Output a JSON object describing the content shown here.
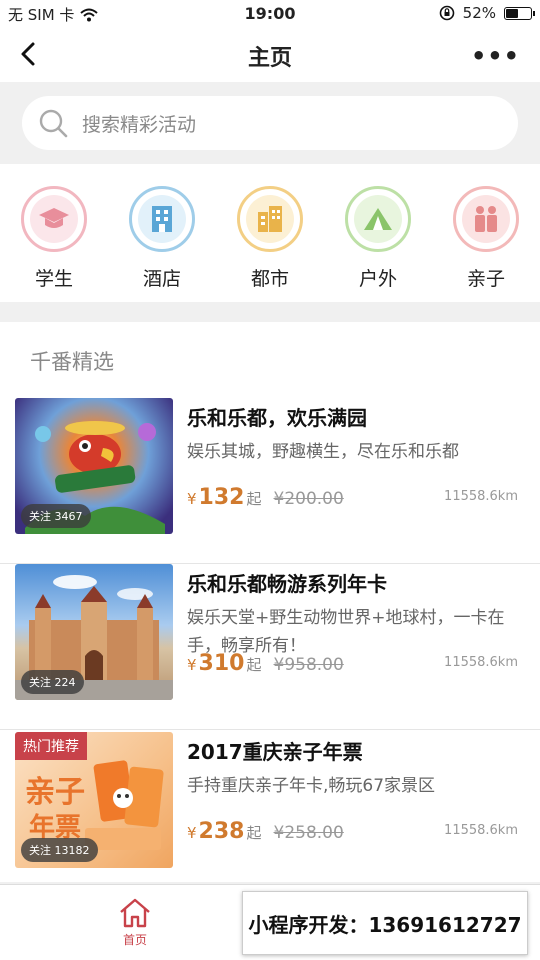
{
  "status_bar": {
    "carrier": "无 SIM 卡",
    "time": "19:00",
    "battery": "52%",
    "battery_level": 0.52
  },
  "nav": {
    "title": "主页"
  },
  "search": {
    "placeholder": "搜索精彩活动"
  },
  "categories": [
    {
      "label": "学生",
      "icon": "graduation-cap-icon",
      "color": "#e88e9b"
    },
    {
      "label": "酒店",
      "icon": "hotel-icon",
      "color": "#5aa6d6"
    },
    {
      "label": "都市",
      "icon": "city-icon",
      "color": "#e9b34a"
    },
    {
      "label": "户外",
      "icon": "tent-icon",
      "color": "#8ac46a"
    },
    {
      "label": "亲子",
      "icon": "family-icon",
      "color": "#e58a8a"
    }
  ],
  "section": {
    "title": "千番精选"
  },
  "items": [
    {
      "name": "乐和乐都，欢乐满园",
      "desc": "娱乐其城，野趣横生，尽在乐和乐都",
      "currency": "¥",
      "price": "132",
      "suffix": "起",
      "original_price": "¥200.00",
      "distance": "11558.6km",
      "follow": "关注 3467",
      "badge": ""
    },
    {
      "name": "乐和乐都畅游系列年卡",
      "desc": "娱乐天堂+野生动物世界+地球村，一卡在手，畅享所有！",
      "currency": "¥",
      "price": "310",
      "suffix": "起",
      "original_price": "¥958.00",
      "distance": "11558.6km",
      "follow": "关注 224",
      "badge": ""
    },
    {
      "name": "2017重庆亲子年票",
      "desc": "手持重庆亲子年卡,畅玩67家景区",
      "currency": "¥",
      "price": "238",
      "suffix": "起",
      "original_price": "¥258.00",
      "distance": "11558.6km",
      "follow": "关注 13182",
      "badge": "热门推荐"
    }
  ],
  "tabbar": {
    "home": "首页"
  },
  "promo": {
    "text": "小程序开发：13691612727"
  },
  "colors": {
    "accent": "#c8424a",
    "price": "#d07a2e"
  }
}
